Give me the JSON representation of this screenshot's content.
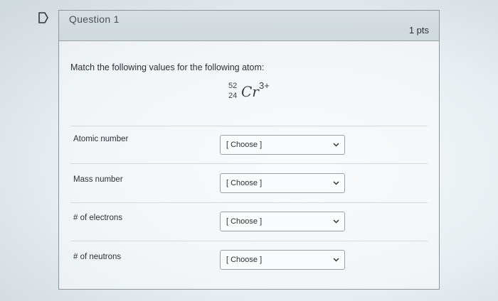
{
  "question": {
    "title": "Question 1",
    "points": "1 pts",
    "prompt": "Match the following values for the following atom:"
  },
  "formula": {
    "mass_number": "52",
    "atomic_number": "24",
    "symbol": "Cr",
    "charge": "3+"
  },
  "rows": [
    {
      "label": "Atomic number",
      "selected": "[ Choose ]"
    },
    {
      "label": "Mass number",
      "selected": "[ Choose ]"
    },
    {
      "label": "# of electrons",
      "selected": "[ Choose ]"
    },
    {
      "label": "# of neutrons",
      "selected": "[ Choose ]"
    }
  ],
  "icons": {
    "flag": "bookmark-flag-icon",
    "dropdown": "chevron-down-icon"
  },
  "colors": {
    "header_bg": "#d7dfe3",
    "border": "#8f979c"
  }
}
